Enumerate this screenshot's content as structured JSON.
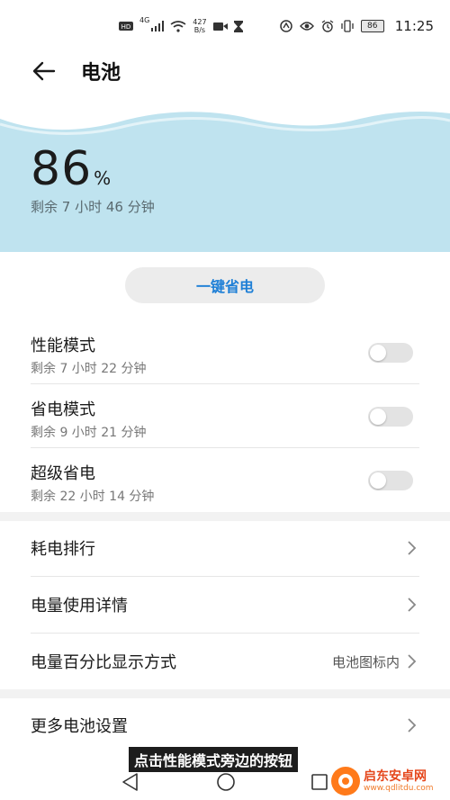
{
  "status_bar": {
    "network_type": "4G",
    "speed_value": "427",
    "speed_unit": "B/s",
    "battery_level": "86",
    "time": "11:25"
  },
  "header": {
    "title": "电池"
  },
  "battery": {
    "percent_value": "86",
    "percent_symbol": "%",
    "remaining": "剩余 7 小时 46 分钟"
  },
  "one_click_save": {
    "label": "一键省电"
  },
  "modes": [
    {
      "title": "性能模式",
      "remaining": "剩余 7 小时 22 分钟",
      "enabled": false
    },
    {
      "title": "省电模式",
      "remaining": "剩余 9 小时 21 分钟",
      "enabled": false
    },
    {
      "title": "超级省电",
      "remaining": "剩余 22 小时 14 分钟",
      "enabled": false
    }
  ],
  "menu": [
    {
      "label": "耗电排行"
    },
    {
      "label": "电量使用详情"
    },
    {
      "label": "电量百分比显示方式",
      "value": "电池图标内"
    },
    {
      "label": "更多电池设置"
    }
  ],
  "caption": "点击性能模式旁边的按钮",
  "watermark": {
    "name": "启东安卓网",
    "url": "www.qdlitdu.com"
  },
  "colors": {
    "hero_bg": "#bfe3ef",
    "accent": "#1e7fd6",
    "toggle_off": "#e3e3e3"
  }
}
